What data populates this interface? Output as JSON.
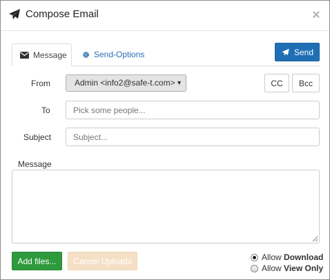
{
  "dialog": {
    "title": "Compose Email",
    "close_glyph": "×",
    "title_icon": "paper-plane-icon",
    "close_icon": "close-icon"
  },
  "tabs": [
    {
      "label": "Message",
      "icon": "envelope-icon",
      "active": true
    },
    {
      "label": "Send-Options",
      "icon": "gear-icon",
      "active": false
    }
  ],
  "send_button": {
    "label": "Send",
    "icon": "paper-plane-icon"
  },
  "form": {
    "from_label": "From",
    "from_value": "Admin <info2@safe-t.com>",
    "cc_label": "CC",
    "bcc_label": "Bcc",
    "to_label": "To",
    "to_placeholder": "Pick some people...",
    "subject_label": "Subject",
    "subject_placeholder": "Subject...",
    "message_label": "Message",
    "message_value": ""
  },
  "footer": {
    "add_files_label": "Add files...",
    "cancel_uploads_label": "Cancel Uploads",
    "radio_options": [
      {
        "prefix": "Allow",
        "emphasis": "Download",
        "checked": true
      },
      {
        "prefix": "Allow",
        "emphasis": "View Only",
        "checked": false
      }
    ]
  },
  "colors": {
    "primary": "#1f6fb5",
    "success": "#2e9a3c",
    "disabled_warning": "#f5e0c6",
    "link": "#2a6db3"
  }
}
